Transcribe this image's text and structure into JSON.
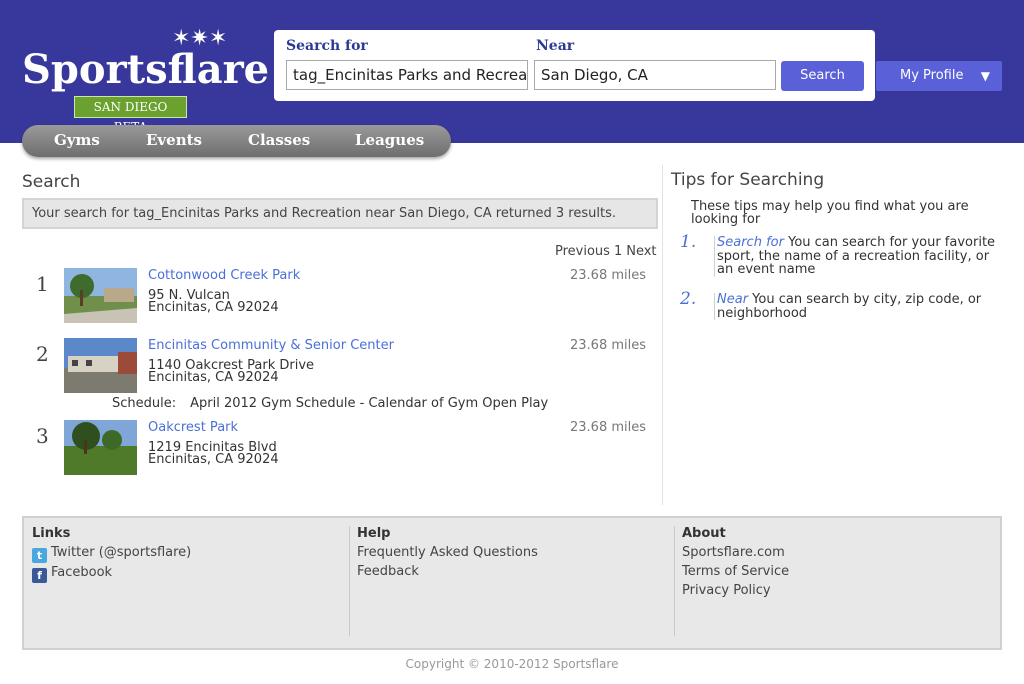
{
  "header": {
    "logo": "Sportsflare",
    "badge": "SAN DIEGO BETA",
    "search": {
      "search_for_label": "Search for",
      "search_for_value": "tag_Encinitas Parks and Recreation",
      "near_label": "Near",
      "near_value": "San Diego, CA",
      "button_label": "Search"
    },
    "profile_label": "My Profile",
    "nav": [
      "Gyms",
      "Events",
      "Classes",
      "Leagues"
    ]
  },
  "main": {
    "title": "Search",
    "banner": "Your search for tag_Encinitas Parks and Recreation near San Diego, CA returned 3 results.",
    "pager": {
      "previous": "Previous",
      "page": "1",
      "next": "Next"
    },
    "results": [
      {
        "num": "1",
        "name": "Cottonwood Creek Park",
        "address1": "95 N. Vulcan",
        "address2": "Encinitas, CA 92024",
        "distance": "23.68 miles"
      },
      {
        "num": "2",
        "name": "Encinitas Community & Senior Center",
        "address1": "1140 Oakcrest Park Drive",
        "address2": "Encinitas, CA 92024",
        "distance": "23.68 miles"
      },
      {
        "num": "3",
        "name": "Oakcrest Park",
        "address1": "1219 Encinitas Blvd",
        "address2": "Encinitas, CA 92024",
        "distance": "23.68 miles"
      }
    ],
    "schedule": {
      "label": "Schedule:",
      "link": "April 2012 Gym Schedule - Calendar of Gym Open Play"
    }
  },
  "tips": {
    "title": "Tips for Searching",
    "intro": "These tips may help you find what you are looking for",
    "items": [
      {
        "num": "1.",
        "keyword": "Search for",
        "text": " You can search for your favorite sport, the name of a recreation facility, or an event name"
      },
      {
        "num": "2.",
        "keyword": "Near",
        "text": " You can search by city, zip code, or neighborhood"
      }
    ]
  },
  "footer": {
    "links": {
      "heading": "Links",
      "twitter": "Twitter (@sportsflare)",
      "facebook": "Facebook"
    },
    "help": {
      "heading": "Help",
      "faq": "Frequently Asked Questions",
      "feedback": "Feedback"
    },
    "about": {
      "heading": "About",
      "site": "Sportsflare.com",
      "terms": "Terms of Service",
      "privacy": "Privacy Policy"
    },
    "copyright": "Copyright © 2010-2012 Sportsflare"
  },
  "colors": {
    "header_bg": "#38389c",
    "accent": "#5a60d8",
    "link": "#4a6fd8",
    "badge": "#6aa12f"
  }
}
